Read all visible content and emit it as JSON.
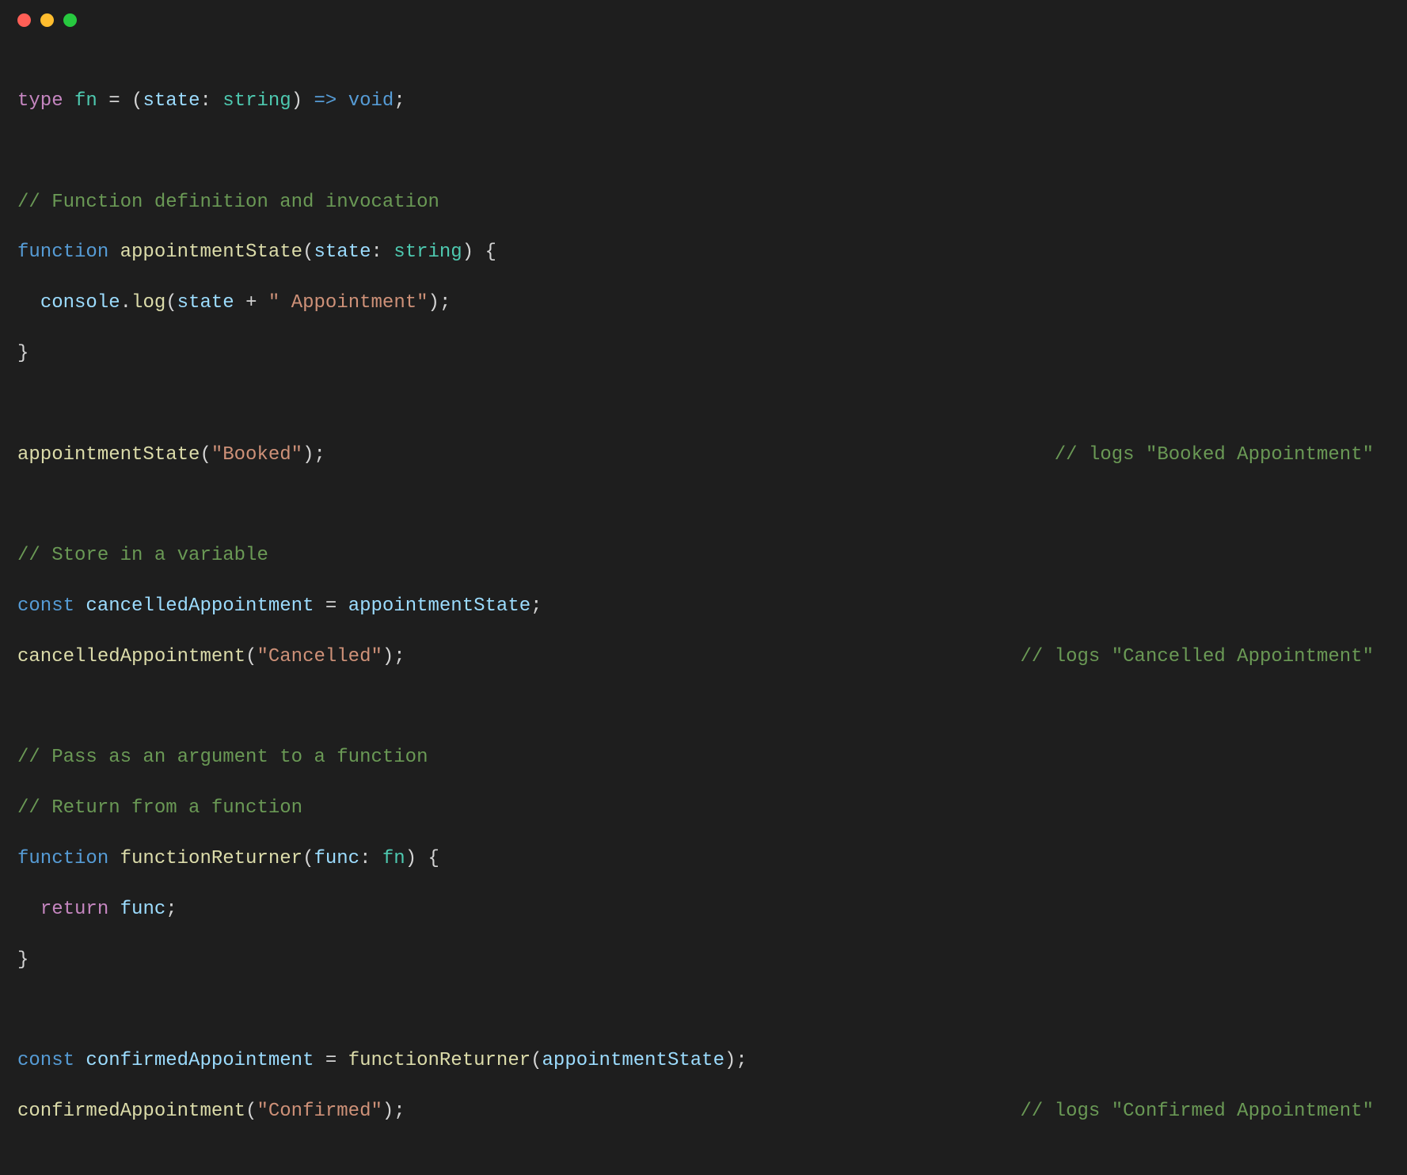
{
  "titlebar": {
    "dots": [
      "red",
      "yellow",
      "green"
    ]
  },
  "code": {
    "line1": {
      "type_kw": "type",
      "type_name": "fn",
      "eq": " = ",
      "lparen": "(",
      "param_name": "state",
      "colon": ": ",
      "param_type": "string",
      "rparen": ")",
      "arrow": " => ",
      "ret": "void",
      "semi": ";"
    },
    "comment_def": "// Function definition and invocation",
    "line_fn_decl": {
      "kw": "function",
      "sp": " ",
      "name": "appointmentState",
      "lparen": "(",
      "param": "state",
      "colon": ": ",
      "ptype": "string",
      "rparen_brace": ") {"
    },
    "line_console": {
      "indent": "  ",
      "obj": "console",
      "dot": ".",
      "method": "log",
      "lparen": "(",
      "arg": "state",
      "plus": " + ",
      "str": "\" Appointment\"",
      "rparen_semi": ");"
    },
    "rbrace": "}",
    "line_call1": {
      "fn": "appointmentState",
      "lparen": "(",
      "str": "\"Booked\"",
      "rparen_semi": ");"
    },
    "comment_call1": "// logs \"Booked Appointment\"",
    "comment_store": "// Store in a variable",
    "line_const1": {
      "kw": "const",
      "sp": " ",
      "name": "cancelledAppointment",
      "eq": " = ",
      "rhs": "appointmentState",
      "semi": ";"
    },
    "line_call2": {
      "fn": "cancelledAppointment",
      "lparen": "(",
      "str": "\"Cancelled\"",
      "rparen_semi": ");"
    },
    "comment_call2": "// logs \"Cancelled Appointment\"",
    "comment_pass": "// Pass as an argument to a function",
    "comment_return": "// Return from a function",
    "line_fn2_decl": {
      "kw": "function",
      "sp": " ",
      "name": "functionReturner",
      "lparen": "(",
      "param": "func",
      "colon": ": ",
      "ptype": "fn",
      "rparen_brace": ") {"
    },
    "line_return": {
      "indent": "  ",
      "kw": "return",
      "sp": " ",
      "val": "func",
      "semi": ";"
    },
    "line_const2": {
      "kw": "const",
      "sp": " ",
      "name": "confirmedAppointment",
      "eq": " = ",
      "fn": "functionReturner",
      "lparen": "(",
      "arg": "appointmentState",
      "rparen_semi": ");"
    },
    "line_call3": {
      "fn": "confirmedAppointment",
      "lparen": "(",
      "str": "\"Confirmed\"",
      "rparen_semi": ");"
    },
    "comment_call3": "// logs \"Confirmed Appointment\""
  }
}
